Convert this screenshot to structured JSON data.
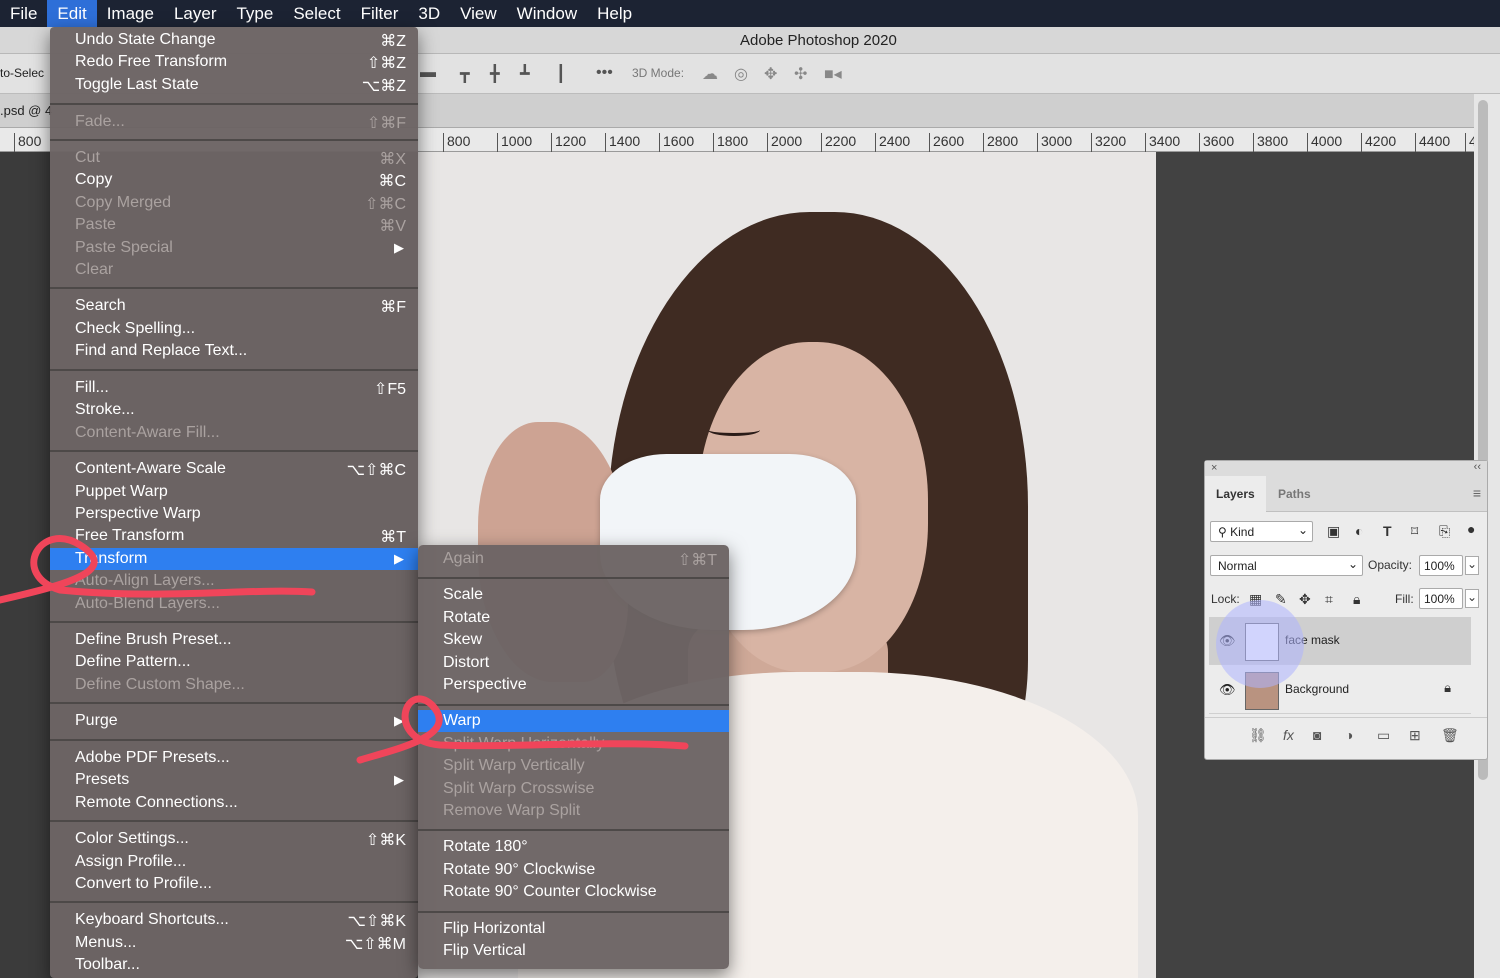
{
  "menubar": {
    "items": [
      "File",
      "Edit",
      "Image",
      "Layer",
      "Type",
      "Select",
      "Filter",
      "3D",
      "View",
      "Window",
      "Help"
    ],
    "active": "Edit"
  },
  "window": {
    "title": "Adobe Photoshop 2020"
  },
  "options_bar": {
    "left_text": "to-Selec",
    "more_icon": "•••",
    "mode_3d_label": "3D Mode:"
  },
  "doc_tab": {
    "label": ".psd @ 4"
  },
  "ruler": {
    "ticks": [
      "800",
      "800",
      "1000",
      "1200",
      "1400",
      "1600",
      "1800",
      "2000",
      "2200",
      "2400",
      "2600",
      "2800",
      "3000",
      "3200",
      "3400",
      "3600",
      "3800",
      "4000",
      "4200",
      "4400",
      "4"
    ]
  },
  "edit_menu": {
    "items": [
      {
        "label": "Undo State Change",
        "shortcut": "⌘Z"
      },
      {
        "label": "Redo Free Transform",
        "shortcut": "⇧⌘Z"
      },
      {
        "label": "Toggle Last State",
        "shortcut": "⌥⌘Z"
      },
      {
        "label": "Fade...",
        "shortcut": "⇧⌘F"
      },
      {
        "label": "Cut",
        "shortcut": "⌘X"
      },
      {
        "label": "Copy",
        "shortcut": "⌘C"
      },
      {
        "label": "Copy Merged",
        "shortcut": "⇧⌘C"
      },
      {
        "label": "Paste",
        "shortcut": "⌘V"
      },
      {
        "label": "Paste Special",
        "shortcut": "▶"
      },
      {
        "label": "Clear",
        "shortcut": ""
      },
      {
        "label": "Search",
        "shortcut": "⌘F"
      },
      {
        "label": "Check Spelling...",
        "shortcut": ""
      },
      {
        "label": "Find and Replace Text...",
        "shortcut": ""
      },
      {
        "label": "Fill...",
        "shortcut": "⇧F5"
      },
      {
        "label": "Stroke...",
        "shortcut": ""
      },
      {
        "label": "Content-Aware Fill...",
        "shortcut": ""
      },
      {
        "label": "Content-Aware Scale",
        "shortcut": "⌥⇧⌘C"
      },
      {
        "label": "Puppet Warp",
        "shortcut": ""
      },
      {
        "label": "Perspective Warp",
        "shortcut": ""
      },
      {
        "label": "Free Transform",
        "shortcut": "⌘T"
      },
      {
        "label": "Transform",
        "shortcut": "▶"
      },
      {
        "label": "Auto-Align Layers...",
        "shortcut": ""
      },
      {
        "label": "Auto-Blend Layers...",
        "shortcut": ""
      },
      {
        "label": "Define Brush Preset...",
        "shortcut": ""
      },
      {
        "label": "Define Pattern...",
        "shortcut": ""
      },
      {
        "label": "Define Custom Shape...",
        "shortcut": ""
      },
      {
        "label": "Purge",
        "shortcut": "▶"
      },
      {
        "label": "Adobe PDF Presets...",
        "shortcut": ""
      },
      {
        "label": "Presets",
        "shortcut": "▶"
      },
      {
        "label": "Remote Connections...",
        "shortcut": ""
      },
      {
        "label": "Color Settings...",
        "shortcut": "⇧⌘K"
      },
      {
        "label": "Assign Profile...",
        "shortcut": ""
      },
      {
        "label": "Convert to Profile...",
        "shortcut": ""
      },
      {
        "label": "Keyboard Shortcuts...",
        "shortcut": "⌥⇧⌘K"
      },
      {
        "label": "Menus...",
        "shortcut": "⌥⇧⌘M"
      },
      {
        "label": "Toolbar...",
        "shortcut": ""
      }
    ]
  },
  "transform_menu": {
    "items": [
      {
        "label": "Again",
        "shortcut": "⇧⌘T"
      },
      {
        "label": "Scale",
        "shortcut": ""
      },
      {
        "label": "Rotate",
        "shortcut": ""
      },
      {
        "label": "Skew",
        "shortcut": ""
      },
      {
        "label": "Distort",
        "shortcut": ""
      },
      {
        "label": "Perspective",
        "shortcut": ""
      },
      {
        "label": "Warp",
        "shortcut": ""
      },
      {
        "label": "Split Warp Horizontally",
        "shortcut": ""
      },
      {
        "label": "Split Warp Vertically",
        "shortcut": ""
      },
      {
        "label": "Split Warp Crosswise",
        "shortcut": ""
      },
      {
        "label": "Remove Warp Split",
        "shortcut": ""
      },
      {
        "label": "Rotate 180°",
        "shortcut": ""
      },
      {
        "label": "Rotate 90° Clockwise",
        "shortcut": ""
      },
      {
        "label": "Rotate 90° Counter Clockwise",
        "shortcut": ""
      },
      {
        "label": "Flip Horizontal",
        "shortcut": ""
      },
      {
        "label": "Flip Vertical",
        "shortcut": ""
      }
    ]
  },
  "layers_panel": {
    "close": "×",
    "collapse": "‹‹",
    "tabs": [
      "Layers",
      "Paths"
    ],
    "active_tab": "Layers",
    "menu_icon": "≡",
    "filter": "Kind",
    "blend_mode": "Normal",
    "opacity_label": "Opacity:",
    "opacity": "100%",
    "lock_label": "Lock:",
    "fill_label": "Fill:",
    "fill": "100%",
    "layers": [
      {
        "name": "face mask",
        "selected": true
      },
      {
        "name": "Background",
        "locked": true
      }
    ],
    "chevron": "⌄"
  }
}
